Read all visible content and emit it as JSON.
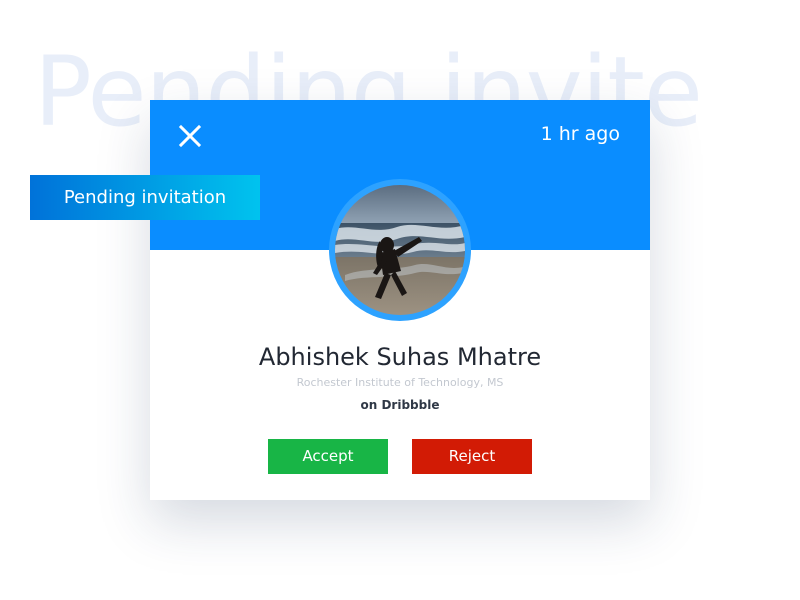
{
  "background_title": "Pending invite",
  "label": "Pending invitation",
  "card": {
    "time_ago": "1 hr ago",
    "name": "Abhishek Suhas Mhatre",
    "school": "Rochester Institute of Technology, MS",
    "source": "on Dribbble",
    "actions": {
      "accept_label": "Accept",
      "reject_label": "Reject"
    },
    "icons": {
      "close": "close-icon",
      "avatar": "profile-photo"
    }
  },
  "colors": {
    "header": "#0a8dff",
    "accept": "#18b546",
    "reject": "#d21b05",
    "label_gradient_start": "#0072d9",
    "label_gradient_end": "#00c3ee"
  }
}
